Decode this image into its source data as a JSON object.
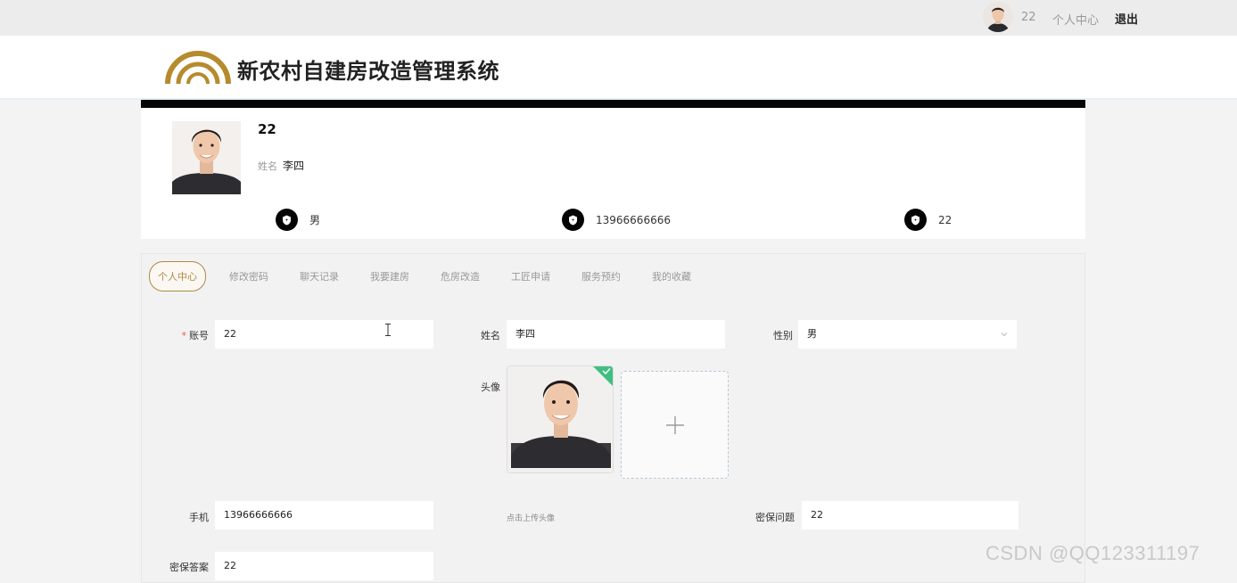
{
  "topbar": {
    "username": "22",
    "center_link": "个人中心",
    "logout": "退出"
  },
  "header": {
    "title": "新农村自建房改造管理系统"
  },
  "profile": {
    "username": "22",
    "realname_label": "姓名",
    "realname": "李四",
    "stats": [
      {
        "icon": "shield-icon",
        "value": "男"
      },
      {
        "icon": "shield-icon",
        "value": "13966666666"
      },
      {
        "icon": "shield-icon",
        "value": "22"
      }
    ]
  },
  "tabs": [
    {
      "label": "个人中心",
      "active": true
    },
    {
      "label": "修改密码"
    },
    {
      "label": "聊天记录"
    },
    {
      "label": "我要建房"
    },
    {
      "label": "危房改造"
    },
    {
      "label": "工匠申请"
    },
    {
      "label": "服务预约"
    },
    {
      "label": "我的收藏"
    }
  ],
  "form": {
    "account_label": "账号",
    "account_required": "*",
    "account_value": "22",
    "name_label": "姓名",
    "name_value": "李四",
    "gender_label": "性别",
    "gender_value": "男",
    "avatar_label": "头像",
    "upload_tip": "点击上传头像",
    "phone_label": "手机",
    "phone_value": "13966666666",
    "question_label": "密保问题",
    "question_value": "22",
    "answer_label": "密保答案",
    "answer_value": "22"
  },
  "watermark": "CSDN @QQ123311197",
  "colors": {
    "accent": "#b08a42",
    "header_bar": "#050505",
    "required": "#e55555",
    "upload_success": "#3fbf7f"
  }
}
